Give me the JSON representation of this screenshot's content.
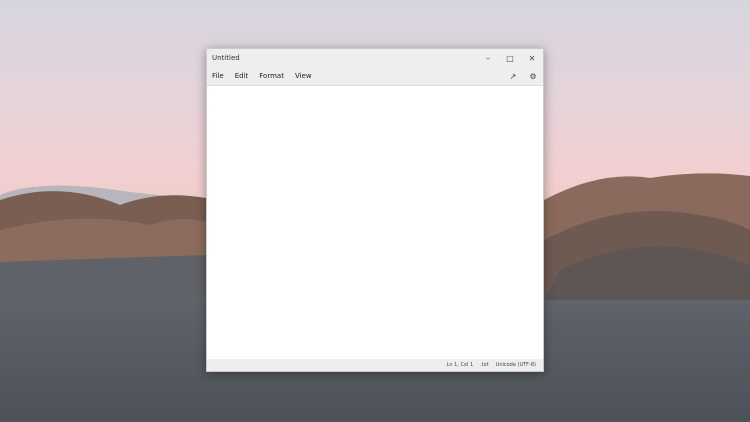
{
  "window": {
    "title": "Untitled",
    "minimize_icon": "minimize-icon",
    "maximize_icon": "maximize-icon",
    "close_icon": "close-icon"
  },
  "menu": {
    "items": [
      "File",
      "Edit",
      "Format",
      "View"
    ],
    "copilot_icon": "rewrite-icon",
    "settings_icon": "gear-icon"
  },
  "editor": {
    "content": ""
  },
  "status": {
    "position": "Ln 1, Col 1",
    "file_type": ".txt",
    "encoding": "Unicode (UTF-8)"
  }
}
